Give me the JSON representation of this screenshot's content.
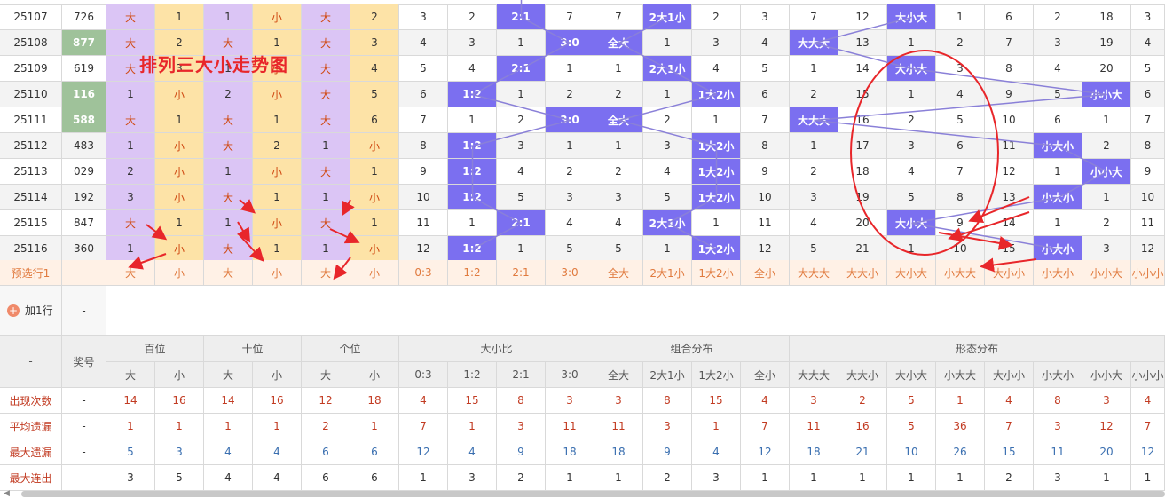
{
  "watermark": "排列三大小走势图",
  "draws": [
    {
      "issue": "25107",
      "num": "726",
      "hl": false,
      "b": [
        "大",
        "1",
        "1",
        "小",
        "大",
        "2"
      ],
      "r": [
        "3",
        "2",
        "2:1",
        "7"
      ],
      "g": [
        "7",
        "2大1小",
        "2",
        "3"
      ],
      "f": [
        "7",
        "12",
        "大小大",
        "1",
        "6",
        "2",
        "18",
        "3"
      ]
    },
    {
      "issue": "25108",
      "num": "877",
      "hl": true,
      "b": [
        "大",
        "2",
        "大",
        "1",
        "大",
        "3"
      ],
      "r": [
        "4",
        "3",
        "1",
        "3:0"
      ],
      "g": [
        "全大",
        "1",
        "3",
        "4"
      ],
      "f": [
        "大大大",
        "13",
        "1",
        "2",
        "7",
        "3",
        "19",
        "4"
      ]
    },
    {
      "issue": "25109",
      "num": "619",
      "hl": false,
      "b": [
        "大",
        "3",
        "1",
        "小",
        "大",
        "4"
      ],
      "r": [
        "5",
        "4",
        "2:1",
        "1"
      ],
      "g": [
        "1",
        "2大1小",
        "4",
        "5"
      ],
      "f": [
        "1",
        "14",
        "大小大",
        "3",
        "8",
        "4",
        "20",
        "5"
      ]
    },
    {
      "issue": "25110",
      "num": "116",
      "hl": true,
      "b": [
        "1",
        "小",
        "2",
        "小",
        "大",
        "5"
      ],
      "r": [
        "6",
        "1:2",
        "1",
        "2"
      ],
      "g": [
        "2",
        "1",
        "1大2小",
        "6"
      ],
      "f": [
        "2",
        "15",
        "1",
        "4",
        "9",
        "5",
        "小小大",
        "6"
      ]
    },
    {
      "issue": "25111",
      "num": "588",
      "hl": true,
      "b": [
        "大",
        "1",
        "大",
        "1",
        "大",
        "6"
      ],
      "r": [
        "7",
        "1",
        "2",
        "3:0"
      ],
      "g": [
        "全大",
        "2",
        "1",
        "7"
      ],
      "f": [
        "大大大",
        "16",
        "2",
        "5",
        "10",
        "6",
        "1",
        "7"
      ]
    },
    {
      "issue": "25112",
      "num": "483",
      "hl": false,
      "b": [
        "1",
        "小",
        "大",
        "2",
        "1",
        "小"
      ],
      "r": [
        "8",
        "1:2",
        "3",
        "1"
      ],
      "g": [
        "1",
        "3",
        "1大2小",
        "8"
      ],
      "f": [
        "1",
        "17",
        "3",
        "6",
        "11",
        "小大小",
        "2",
        "8"
      ]
    },
    {
      "issue": "25113",
      "num": "029",
      "hl": false,
      "b": [
        "2",
        "小",
        "1",
        "小",
        "大",
        "1"
      ],
      "r": [
        "9",
        "1:2",
        "4",
        "2"
      ],
      "g": [
        "2",
        "4",
        "1大2小",
        "9"
      ],
      "f": [
        "2",
        "18",
        "4",
        "7",
        "12",
        "1",
        "小小大",
        "9"
      ]
    },
    {
      "issue": "25114",
      "num": "192",
      "hl": false,
      "b": [
        "3",
        "小",
        "大",
        "1",
        "1",
        "小"
      ],
      "r": [
        "10",
        "1:2",
        "5",
        "3"
      ],
      "g": [
        "3",
        "5",
        "1大2小",
        "10"
      ],
      "f": [
        "3",
        "19",
        "5",
        "8",
        "13",
        "小大小",
        "1",
        "10"
      ]
    },
    {
      "issue": "25115",
      "num": "847",
      "hl": false,
      "b": [
        "大",
        "1",
        "1",
        "小",
        "大",
        "1"
      ],
      "r": [
        "11",
        "1",
        "2:1",
        "4"
      ],
      "g": [
        "4",
        "2大1小",
        "1",
        "11"
      ],
      "f": [
        "4",
        "20",
        "大小大",
        "9",
        "14",
        "1",
        "2",
        "11"
      ]
    },
    {
      "issue": "25116",
      "num": "360",
      "hl": false,
      "b": [
        "1",
        "小",
        "大",
        "1",
        "1",
        "小"
      ],
      "r": [
        "12",
        "1:2",
        "1",
        "5"
      ],
      "g": [
        "5",
        "1",
        "1大2小",
        "12"
      ],
      "f": [
        "5",
        "21",
        "1",
        "10",
        "15",
        "小大小",
        "3",
        "12"
      ]
    }
  ],
  "predict": {
    "label": "预选行1",
    "dash": "-",
    "b": [
      "大",
      "小",
      "大",
      "小",
      "大",
      "小"
    ],
    "r": [
      "0:3",
      "1:2",
      "2:1",
      "3:0"
    ],
    "g": [
      "全大",
      "2大1小",
      "1大2小",
      "全小"
    ],
    "f": [
      "大大大",
      "大大小",
      "大小大",
      "小大大",
      "大小小",
      "小大小",
      "小小大",
      "小小小"
    ]
  },
  "add_row": {
    "label": "加1行",
    "dash": "-",
    "icon": "plus-circle-icon"
  },
  "header": {
    "dash": "-",
    "prize": "奖号",
    "groups": [
      "百位",
      "十位",
      "个位",
      "大小比",
      "组合分布",
      "形态分布"
    ],
    "sub_b": [
      "大",
      "小",
      "大",
      "小",
      "大",
      "小"
    ],
    "sub_r": [
      "0:3",
      "1:2",
      "2:1",
      "3:0"
    ],
    "sub_g": [
      "全大",
      "2大1小",
      "1大2小",
      "全小"
    ],
    "sub_f": [
      "大大大",
      "大大小",
      "大小大",
      "小大大",
      "大小小",
      "小大小",
      "小小大",
      "小小小"
    ]
  },
  "stats": [
    {
      "label": "出现次数",
      "color": "red",
      "dash": "-",
      "v": [
        "14",
        "16",
        "14",
        "16",
        "12",
        "18",
        "4",
        "15",
        "8",
        "3",
        "3",
        "8",
        "15",
        "4",
        "3",
        "2",
        "5",
        "1",
        "4",
        "8",
        "3",
        "4"
      ]
    },
    {
      "label": "平均遗漏",
      "color": "red",
      "dash": "-",
      "v": [
        "1",
        "1",
        "1",
        "1",
        "2",
        "1",
        "7",
        "1",
        "3",
        "11",
        "11",
        "3",
        "1",
        "7",
        "11",
        "16",
        "5",
        "36",
        "7",
        "3",
        "12",
        "7"
      ]
    },
    {
      "label": "最大遗漏",
      "color": "blue",
      "dash": "-",
      "v": [
        "5",
        "3",
        "4",
        "4",
        "6",
        "6",
        "12",
        "4",
        "9",
        "18",
        "18",
        "9",
        "4",
        "12",
        "18",
        "21",
        "10",
        "26",
        "15",
        "11",
        "20",
        "12"
      ]
    },
    {
      "label": "最大连出",
      "color": "dark",
      "dash": "-",
      "v": [
        "3",
        "5",
        "4",
        "4",
        "6",
        "6",
        "1",
        "3",
        "2",
        "1",
        "1",
        "2",
        "3",
        "1",
        "1",
        "1",
        "1",
        "1",
        "2",
        "3",
        "1",
        "1"
      ]
    }
  ],
  "colors": {
    "purple": "#7b6ff0",
    "big": "#dbc5f5",
    "small": "#fde3a7",
    "green": "#9fc29a",
    "annotation": "#e8262a"
  }
}
